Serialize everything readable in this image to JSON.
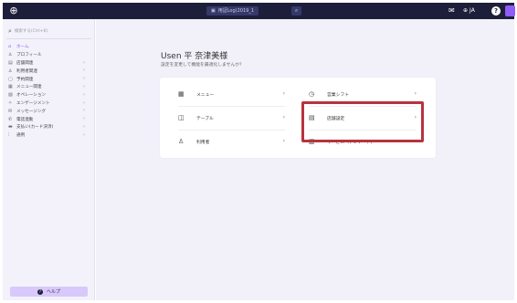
{
  "topbar": {
    "logo_glyph": "⊕",
    "center_icon": "store-icon",
    "center_label": "用証Log(2019_1",
    "search_glyph": "⌕",
    "mail_glyph": "✉",
    "lang_glyph": "⊕",
    "lang_label": "JA",
    "help_glyph": "?",
    "avatar_label": ""
  },
  "sidebar": {
    "search_placeholder": "検索する(Ctrl+K)",
    "items": [
      {
        "icon": "home-icon",
        "glyph": "⌂",
        "label": "ホーム",
        "chevron": "",
        "active": true
      },
      {
        "icon": "person-icon",
        "glyph": "♙",
        "label": "プロフィール",
        "chevron": ""
      },
      {
        "icon": "store-icon",
        "glyph": "▤",
        "label": "店舗関連",
        "chevron": "›"
      },
      {
        "icon": "users-icon",
        "glyph": "♙",
        "label": "利用者関連",
        "chevron": "›"
      },
      {
        "icon": "calendar-icon",
        "glyph": "▢",
        "label": "予約関連",
        "chevron": "›"
      },
      {
        "icon": "menu-icon",
        "glyph": "▦",
        "label": "メニュー関連",
        "chevron": "›"
      },
      {
        "icon": "option-icon",
        "glyph": "▨",
        "label": "オペレーション",
        "chevron": "›"
      },
      {
        "icon": "engagement-icon",
        "glyph": "✧",
        "label": "エンゲージメント",
        "chevron": "›"
      },
      {
        "icon": "message-icon",
        "glyph": "✉",
        "label": "メッセージング",
        "chevron": "›"
      },
      {
        "icon": "phone-icon",
        "glyph": "✆",
        "label": "電話連動",
        "chevron": "›"
      },
      {
        "icon": "card-icon",
        "glyph": "▬",
        "label": "支払い(カード決済)",
        "chevron": "›"
      },
      {
        "icon": "chart-icon",
        "glyph": "⫶",
        "label": "通例",
        "chevron": "›"
      }
    ],
    "help_label": "ヘルプ",
    "help_glyph": "?"
  },
  "main": {
    "greeting": "Usen 平 奈津美様",
    "subtitle": "設定を変更して機能を最適化しませんか？",
    "cards": [
      {
        "icon": "menu-grid-icon",
        "glyph": "▦",
        "label": "メニュー",
        "chevron": "›"
      },
      {
        "icon": "clock-icon",
        "glyph": "◷",
        "label": "営業シフト",
        "chevron": "›"
      },
      {
        "icon": "table-icon",
        "glyph": "◫",
        "label": "テーブル",
        "chevron": "›"
      },
      {
        "icon": "store-settings-icon",
        "glyph": "▤",
        "label": "店舗設定",
        "chevron": "›"
      },
      {
        "icon": "users-icon",
        "glyph": "♙",
        "label": "利用者",
        "chevron": "›"
      },
      {
        "icon": "survey-icon",
        "glyph": "▥",
        "label": "サービス（アンケート）",
        "chevron": "›"
      }
    ]
  },
  "colors": {
    "topbar": "#1d1f3a",
    "accent": "#8b5cf6",
    "highlight": "#b8333d",
    "sidebar_bg": "#f3f2fb",
    "main_bg": "#f2f1fa"
  }
}
